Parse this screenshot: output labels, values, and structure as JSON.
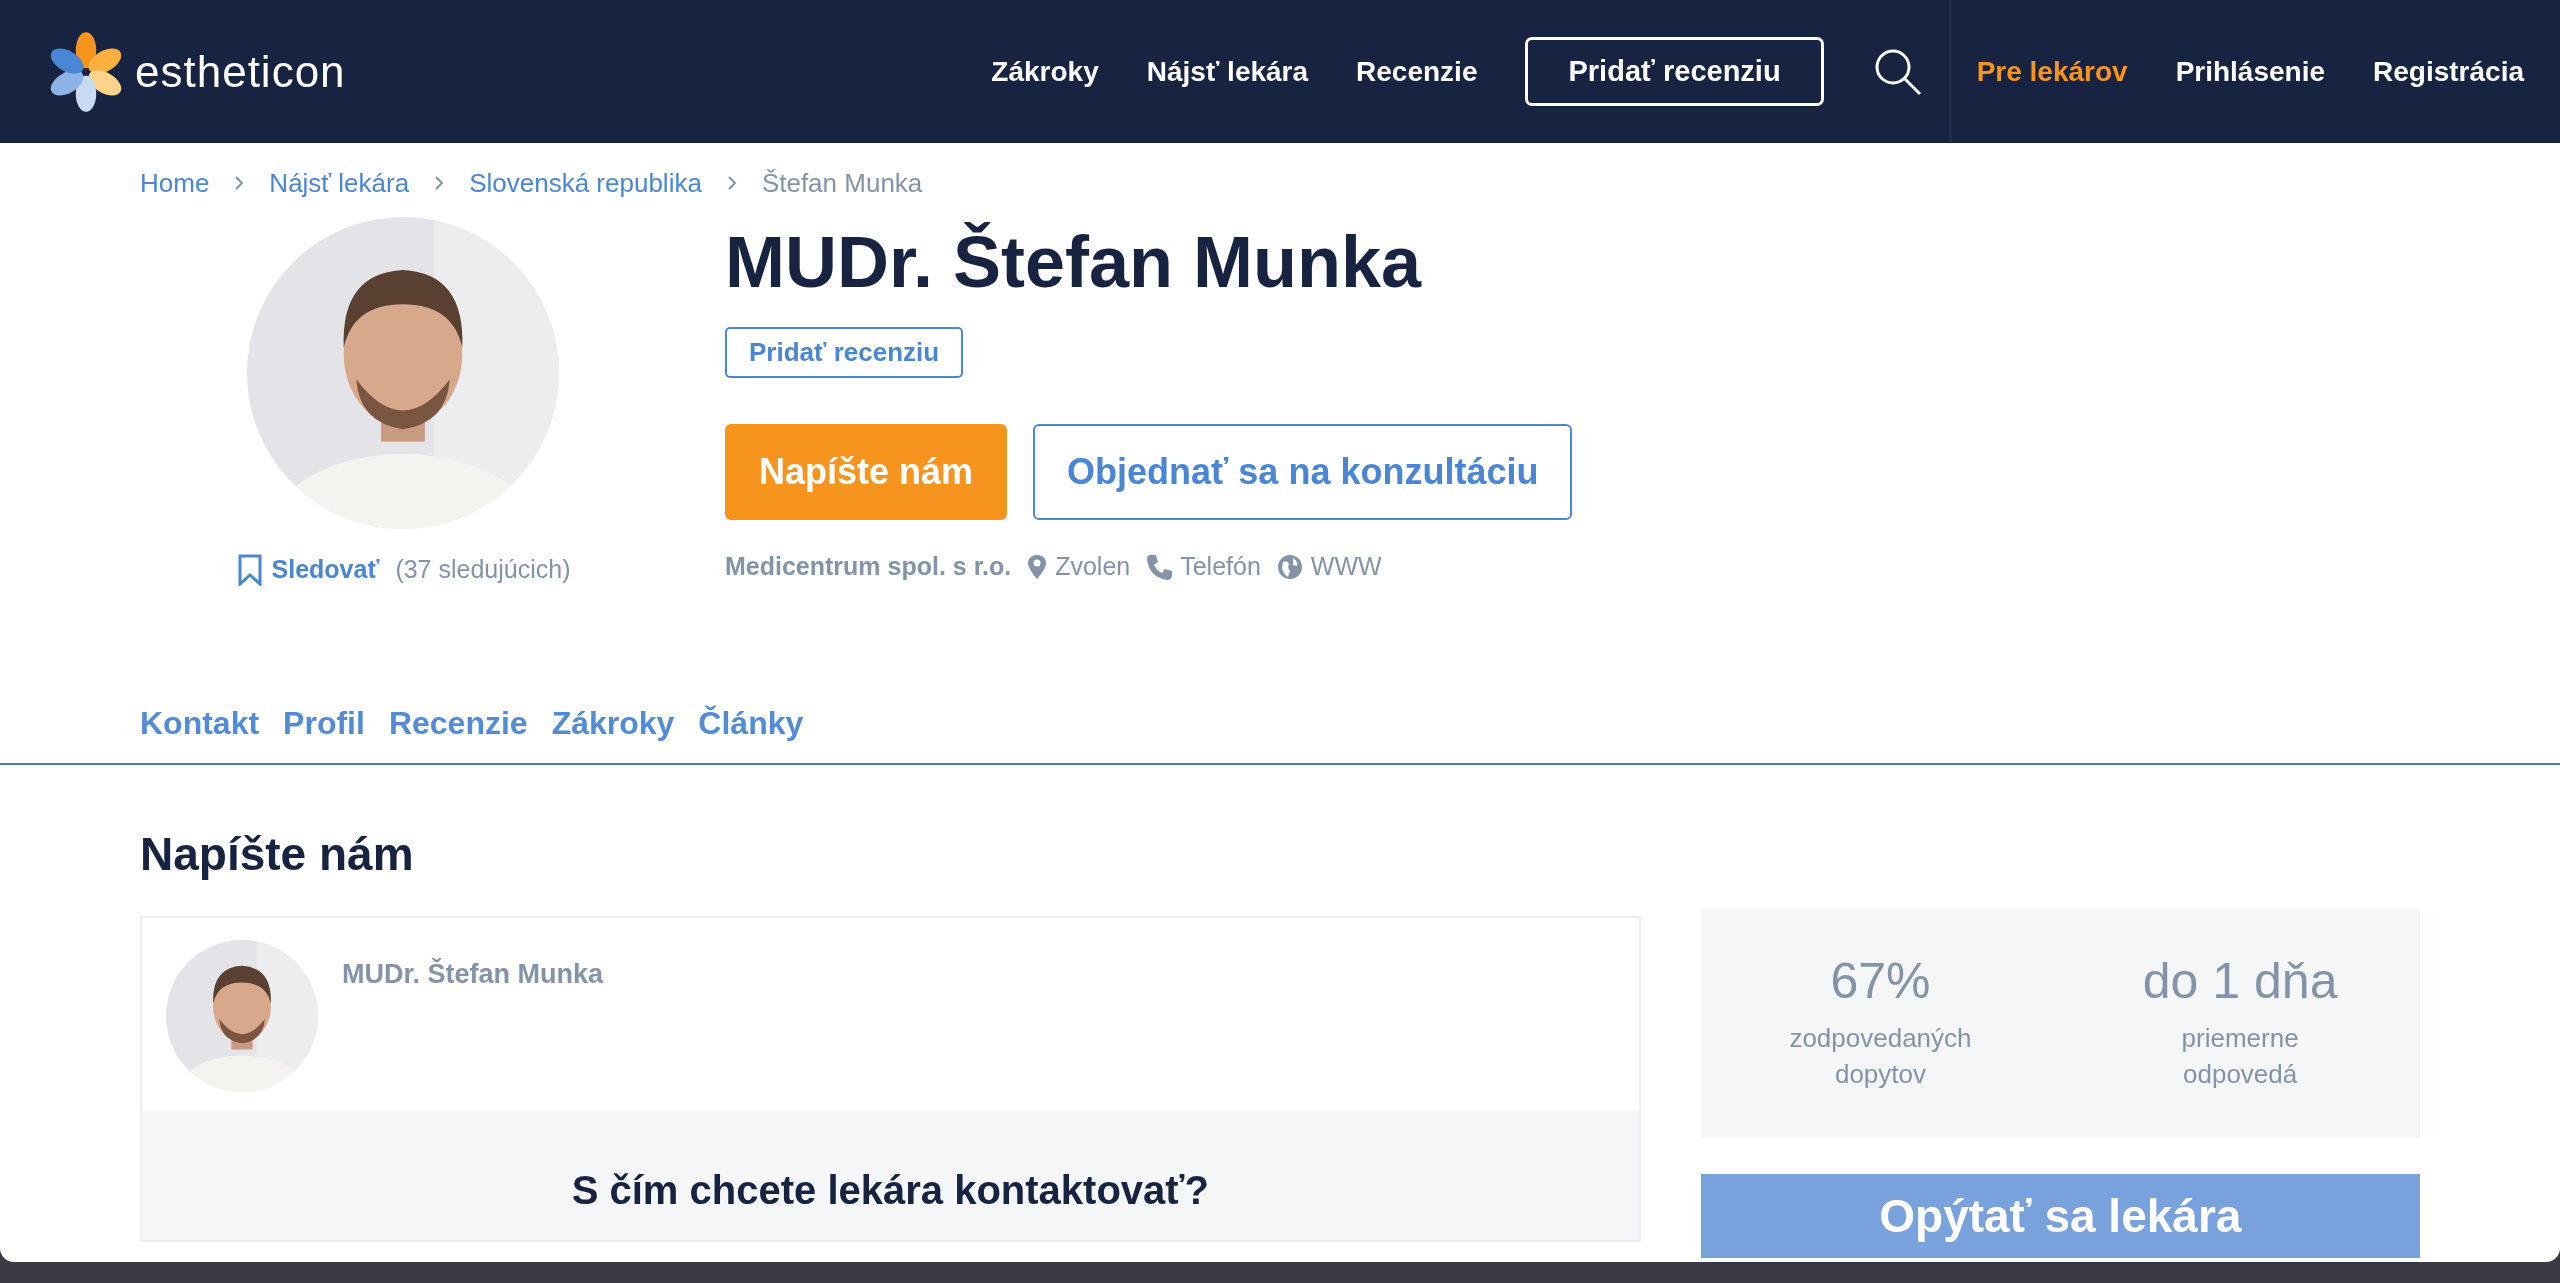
{
  "header": {
    "logo": "estheticon",
    "nav": [
      {
        "label": "Zákroky",
        "highlighted": false
      },
      {
        "label": "Nájsť lekára",
        "highlighted": false
      },
      {
        "label": "Recenzie",
        "highlighted": false
      }
    ],
    "cta": "Pridať recenziu",
    "account": [
      {
        "label": "Pre lekárov",
        "highlighted": true
      },
      {
        "label": "Prihlásenie",
        "highlighted": false
      },
      {
        "label": "Registrácia",
        "highlighted": false
      }
    ]
  },
  "breadcrumb": [
    {
      "label": "Home",
      "current": false
    },
    {
      "label": "Nájsť lekára",
      "current": false
    },
    {
      "label": "Slovenská republika",
      "current": false
    },
    {
      "label": "Štefan Munka",
      "current": true
    }
  ],
  "profile": {
    "name": "MUDr. Štefan Munka",
    "review_button": "Pridať recenziu",
    "primary_button": "Napíšte nám",
    "secondary_button": "Objednať sa na konzultáciu",
    "follow": {
      "label": "Sledovať",
      "count": "(37 sledujúcich)"
    },
    "clinic": "Medicentrum spol. s r.o.",
    "links": [
      {
        "kind": "location",
        "label": "Zvolen"
      },
      {
        "kind": "phone",
        "label": "Telefón"
      },
      {
        "kind": "web",
        "label": "WWW"
      }
    ]
  },
  "tabs": [
    {
      "label": "Kontakt"
    },
    {
      "label": "Profil"
    },
    {
      "label": "Recenzie"
    },
    {
      "label": "Zákroky"
    },
    {
      "label": "Články"
    }
  ],
  "contact": {
    "heading": "Napíšte nám",
    "card_name": "MUDr. Štefan Munka",
    "question": "S čím chcete lekára kontaktovať?"
  },
  "stats": [
    {
      "value": "67%",
      "caption": "zodpovedaných dopytov"
    },
    {
      "value": "do 1 dňa",
      "caption": "priemerne odpovedá"
    }
  ],
  "ask_button": "Opýtať sa lekára"
}
